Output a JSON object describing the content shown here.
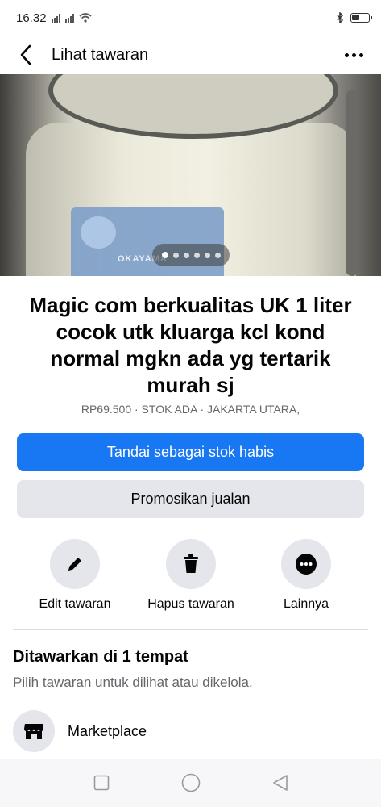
{
  "status_bar": {
    "time": "16.32"
  },
  "header": {
    "title": "Lihat tawaran"
  },
  "photo": {
    "brand_text": "OKAYAMA",
    "image_count": 6,
    "active_index": 0
  },
  "listing": {
    "title": "Magic com berkualitas UK 1 liter cocok utk kluarga kcl kond normal mgkn ada yg tertarik murah sj",
    "meta": "RP69.500 · STOK ADA · JAKARTA UTARA,"
  },
  "buttons": {
    "primary_label": "Tandai sebagai stok habis",
    "secondary_label": "Promosikan jualan"
  },
  "actions": [
    {
      "label": "Edit tawaran",
      "icon": "pencil-icon"
    },
    {
      "label": "Hapus tawaran",
      "icon": "trash-icon"
    },
    {
      "label": "Lainnya",
      "icon": "more-icon"
    }
  ],
  "section": {
    "title": "Ditawarkan di 1 tempat",
    "subtitle": "Pilih tawaran untuk dilihat atau dikelola."
  },
  "marketplace": {
    "label": "Marketplace",
    "icon": "shop-icon"
  },
  "colors": {
    "primary": "#1877f2",
    "secondary_bg": "#e4e6eb",
    "muted_text": "#65676b"
  }
}
